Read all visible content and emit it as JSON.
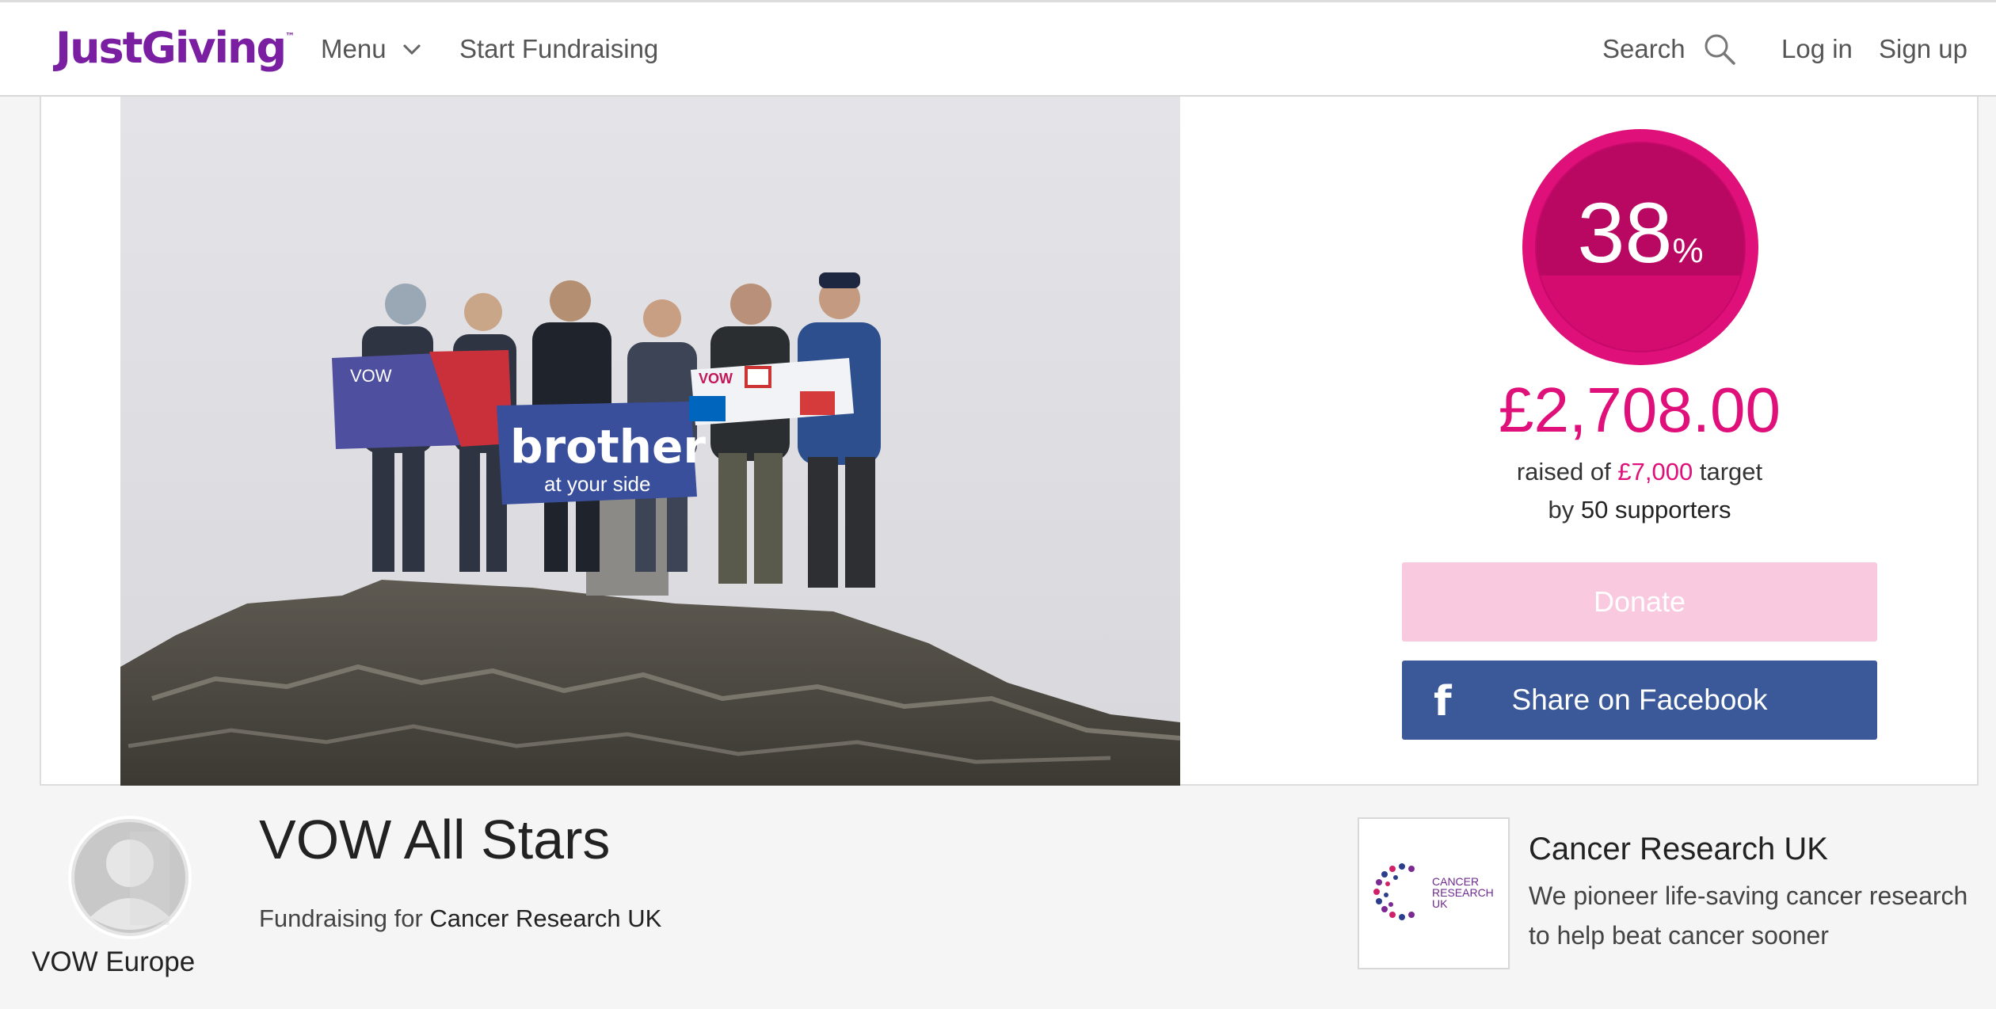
{
  "nav": {
    "logo": "JustGiving",
    "logo_tm": "™",
    "menu_label": "Menu",
    "start_label": "Start Fundraising",
    "search_label": "Search",
    "login_label": "Log in",
    "signup_label": "Sign up"
  },
  "progress": {
    "percent": "38",
    "percent_sign": "%",
    "fraction": 0.38,
    "amount": "£2,708.00",
    "raised_prefix": "raised of",
    "target": "£7,000",
    "target_suffix": "target",
    "by_label": "by",
    "supporters": "50 supporters",
    "donate_label": "Donate",
    "facebook_label": "Share on Facebook",
    "facebook_icon": "f"
  },
  "page": {
    "owner_name": "VOW Europe",
    "title": "VOW All Stars",
    "fundraising_prefix": "Fundraising for",
    "charity_link": "Cancer Research UK"
  },
  "charity": {
    "name": "Cancer Research UK",
    "description": "We pioneer life-saving cancer research to help beat cancer sooner",
    "logo_text": [
      "CANCER",
      "RESEARCH",
      "UK"
    ]
  },
  "photo": {
    "banner_left": "VOW",
    "banner_center_top": "brother",
    "banner_center_bottom": "at your side",
    "banner_right": "VOW"
  },
  "colors": {
    "brand_purple": "#7a1fa2",
    "accent_pink": "#e0107a",
    "donate_disabled": "#f9c9df",
    "facebook_blue": "#3b5998"
  },
  "icons": {
    "menu": "chevron-down-icon",
    "search": "search-icon",
    "facebook": "facebook-icon",
    "avatar": "user-avatar-icon"
  }
}
